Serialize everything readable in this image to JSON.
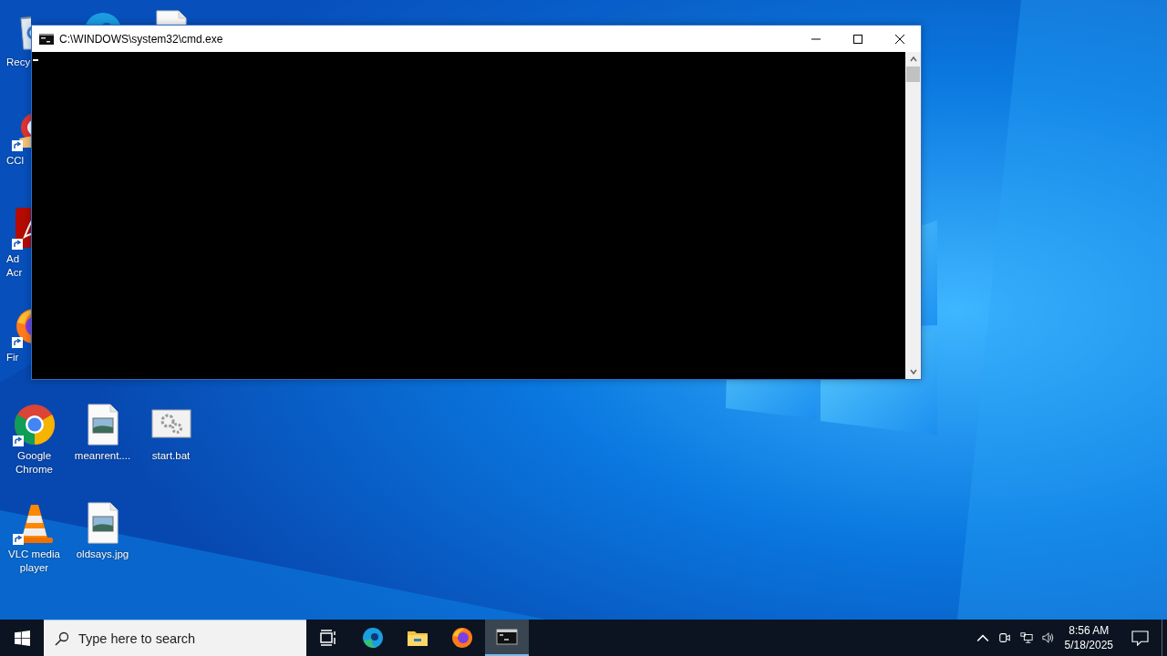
{
  "desktop": {
    "icons": [
      {
        "kind": "recycle-bin",
        "label": "Recy",
        "shortcut": false
      },
      {
        "kind": "ccleaner",
        "label": "CCl",
        "shortcut": true
      },
      {
        "kind": "acrobat",
        "label": "Ad\nAcr",
        "shortcut": true
      },
      {
        "kind": "firefox",
        "label": "Fir",
        "shortcut": true
      },
      {
        "kind": "chrome",
        "label": "Google\nChrome",
        "shortcut": true
      },
      {
        "kind": "vlc",
        "label": "VLC media\nplayer",
        "shortcut": true
      },
      {
        "kind": "edge",
        "shortcut": false
      },
      {
        "kind": "image-file",
        "label": "meanrent....",
        "shortcut": false
      },
      {
        "kind": "image-file",
        "label": "oldsays.jpg",
        "shortcut": false
      },
      {
        "kind": "document",
        "shortcut": false
      },
      {
        "kind": "batch-file",
        "label": "start.bat",
        "shortcut": false
      }
    ]
  },
  "window": {
    "title": "C:\\WINDOWS\\system32\\cmd.exe"
  },
  "taskbar": {
    "search": {
      "placeholder": "Type here to search"
    },
    "apps": [
      {
        "kind": "task-view",
        "selected": false
      },
      {
        "kind": "edge",
        "selected": false
      },
      {
        "kind": "explorer",
        "selected": false
      },
      {
        "kind": "firefox",
        "selected": false
      },
      {
        "kind": "cmd",
        "selected": true
      }
    ],
    "clock": {
      "time": "8:56 AM",
      "date": "5/18/2025"
    }
  }
}
